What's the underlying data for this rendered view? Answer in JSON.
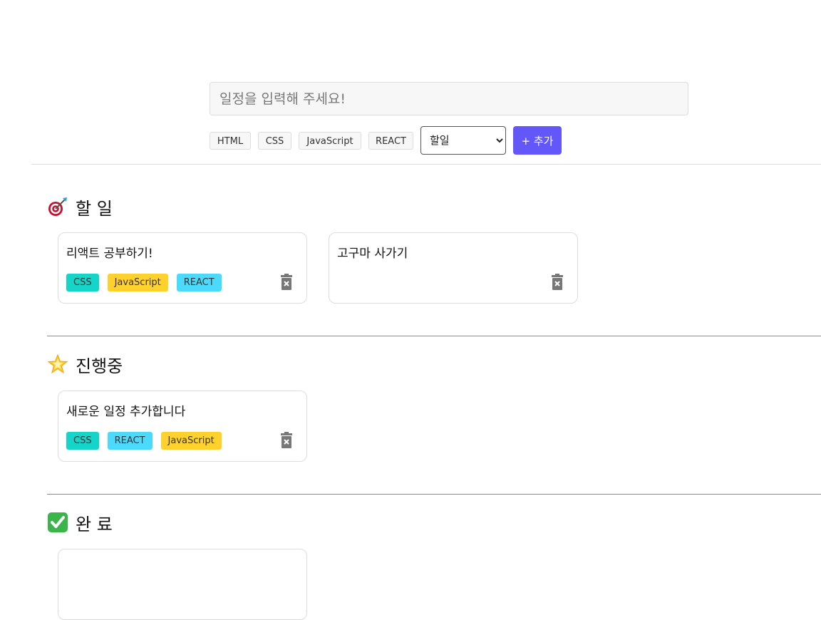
{
  "form": {
    "placeholder": "일정을 입력해 주세요!",
    "tags": [
      "HTML",
      "CSS",
      "JavaScript",
      "REACT"
    ],
    "status_selected": "할일",
    "add_label": "+ 추가"
  },
  "tag_colors": {
    "HTML": "#fda821",
    "CSS": "#15d4c8",
    "JavaScript": "#ffd12c",
    "REACT": "#4cdafc"
  },
  "columns": [
    {
      "title": "할 일",
      "icon": "target-icon",
      "tasks": [
        {
          "title": "리액트 공부하기!",
          "tags": [
            "CSS",
            "JavaScript",
            "REACT"
          ]
        },
        {
          "title": "고구마 사가기",
          "tags": []
        }
      ]
    },
    {
      "title": "진행중",
      "icon": "star-icon",
      "tasks": [
        {
          "title": "새로운 일정 추가합니다",
          "tags": [
            "CSS",
            "REACT",
            "JavaScript"
          ]
        }
      ]
    },
    {
      "title": "완 료",
      "icon": "check-icon",
      "tasks": [
        {
          "title": "",
          "tags": []
        }
      ]
    }
  ]
}
